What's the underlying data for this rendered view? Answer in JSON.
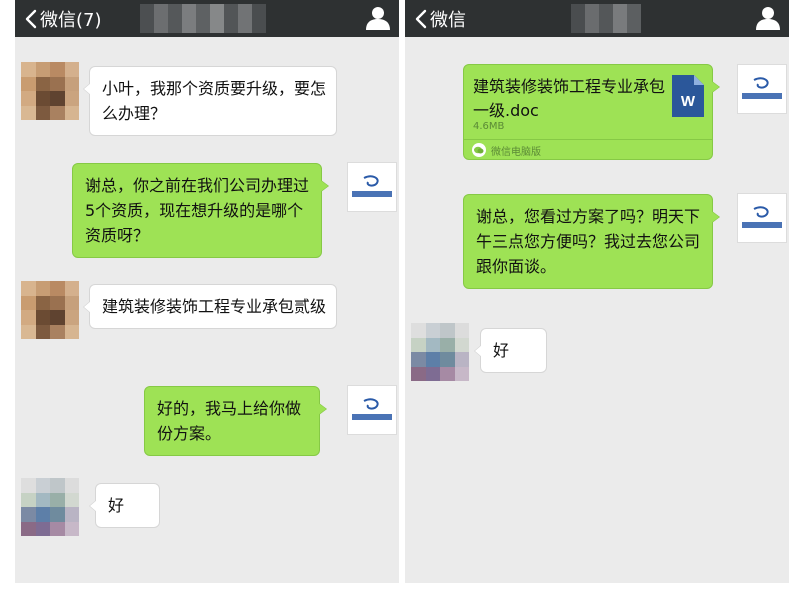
{
  "colors": {
    "topbar": "#2e3132",
    "chat_background": "#ebebeb",
    "bubble_incoming": "#ffffff",
    "bubble_outgoing": "#9ee255",
    "doc_icon_blue": "#2b579a"
  },
  "left_panel": {
    "header": {
      "back_label": "微信(7)",
      "back_icon": "chevron-left-icon",
      "profile_icon": "person-icon"
    },
    "messages": [
      {
        "direction": "incoming",
        "text": "小叶，我那个资质要升级，要怎么办理？"
      },
      {
        "direction": "outgoing",
        "text": "谢总，你之前在我们公司办理过5个资质，现在想升级的是哪个资质呀？"
      },
      {
        "direction": "incoming",
        "text": "建筑装修装饰工程专业承包贰级"
      },
      {
        "direction": "outgoing",
        "text": "好的，我马上给你做份方案。"
      },
      {
        "direction": "incoming",
        "text": "好"
      }
    ]
  },
  "right_panel": {
    "header": {
      "back_label": "微信",
      "back_icon": "chevron-left-icon",
      "profile_icon": "person-icon"
    },
    "file_message": {
      "file_name": "建筑装修装饰工程专业承包一级.doc",
      "file_size": "4.6MB",
      "file_icon_letter": "W",
      "source_label": "微信电脑版"
    },
    "messages": [
      {
        "direction": "outgoing",
        "text": "谢总，您看过方案了吗？明天下午三点您方便吗？我过去您公司跟你面谈。"
      },
      {
        "direction": "incoming",
        "text": "好"
      }
    ]
  }
}
